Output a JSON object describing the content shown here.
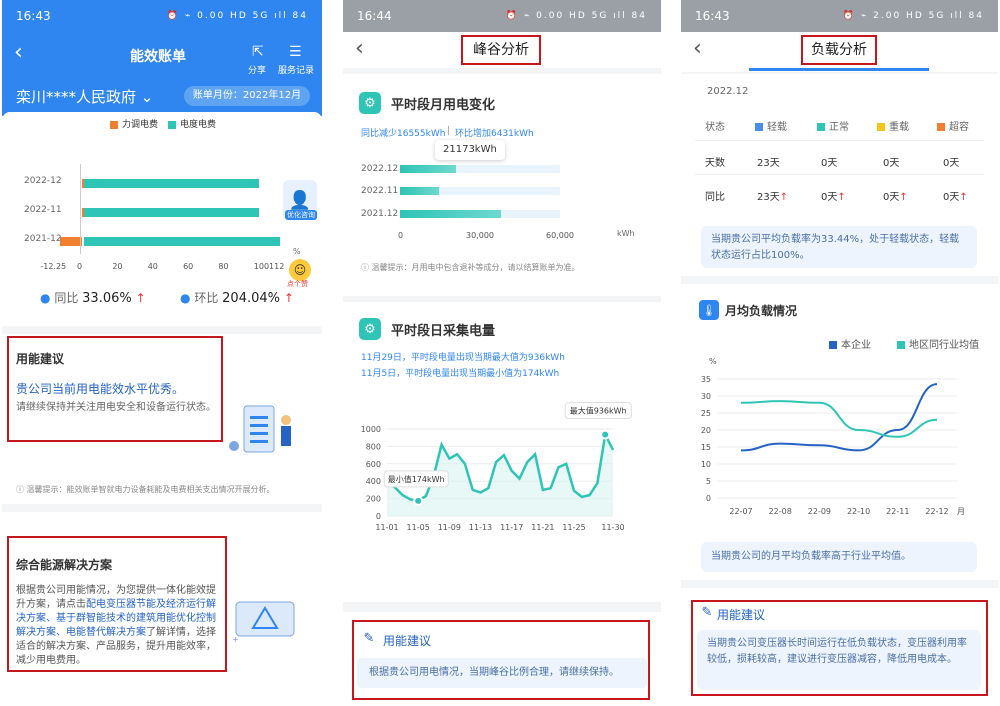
{
  "p1": {
    "status_time": "16:43",
    "status_icons": "⏰ ⌁ 0.00 HD 5G ıll 84",
    "title": "能效账单",
    "share": "分享",
    "records": "服务记录",
    "org": "栾川****人民政府",
    "bill_month_label": "账单月份：2022年12月",
    "legend": [
      "力调电费",
      "电度电费"
    ],
    "rows": [
      "2022-12",
      "2022-11",
      "2021-12"
    ],
    "xticks": [
      "-12.25",
      "0",
      "20",
      "40",
      "60",
      "80",
      "100112"
    ],
    "yoy_label": "同比",
    "yoy_value": "33.06%",
    "mom_label": "环比",
    "mom_value": "204.04%",
    "pct": "%",
    "optimize": "优化咨询",
    "click": "点个赞",
    "advice_title": "用能建议",
    "advice_head": "贵公司当前用电能效水平优秀。",
    "advice_body": "请继续保持并关注用电安全和设备运行状态。",
    "tip": "温馨提示：能效账单智就电力设备耗能及电费相关支出情况开展分析。",
    "solution_title": "综合能源解决方案",
    "solution_body": [
      "根据贵公司用能情况，为您提供一体化能效提升方案，请点击",
      "配电变压器节能及经济运行解决方案、基于群智能技术的建筑用能优化控制解决方案、电能替代解决方案",
      "了解详情，选择适合的解决方案、产品服务，提升用能效率，减少用电费用。"
    ]
  },
  "p2": {
    "status_time": "16:44",
    "status_icons": "⏰ ⌁ 0.00 HD 5G ıll 84",
    "title": "峰谷分析",
    "sec1_title": "平时段月用电变化",
    "sec1_yoy": "同比减少16555kWh",
    "sec1_mom": "环比增加6431kWh",
    "tooltip": "21173kWh",
    "rows": [
      "2022.12",
      "2022.11",
      "2021.12"
    ],
    "xticks": [
      "0",
      "30,000",
      "60,000"
    ],
    "xunit": "kWh",
    "tip": "温馨提示：月用电中包含退补等成分，请以结算账单为准。",
    "sec2_title": "平时段日采集电量",
    "line1": "11月29日，平时段电量出现当期最大值为936kWh",
    "line2": "11月5日，平时段电量出现当期最小值为174kWh",
    "max_label": "最大值936kWh",
    "min_label": "最小值174kWh",
    "yticks": [
      "1000",
      "800",
      "600",
      "400",
      "200",
      "0"
    ],
    "dates": [
      "11-01",
      "11-05",
      "11-09",
      "11-13",
      "11-17",
      "11-21",
      "11-25",
      "11-30"
    ],
    "advice_title": "用能建议",
    "advice_body": "根据贵公司用电情况，当期峰谷比例合理，请继续保持。"
  },
  "p3": {
    "status_time": "16:43",
    "status_icons": "⏰ ⌁ 2.00 HD 5G ıll 84",
    "title": "负载分析",
    "month": "2022.12",
    "table": {
      "head": [
        "状态",
        "轻载",
        "正常",
        "重载",
        "超容"
      ],
      "r1": [
        "天数",
        "23天",
        "0天",
        "0天",
        "0天"
      ],
      "r2": [
        "同比",
        "23天",
        "0天",
        "0天",
        "0天"
      ]
    },
    "note1": "当期贵公司平均负载率为33.44%，处于轻载状态，轻载状态运行占比100%。",
    "sec_title": "月均负载情况",
    "legend": [
      "本企业",
      "地区同行业均值"
    ],
    "yunit": "%",
    "yticks": [
      "35",
      "30",
      "25",
      "20",
      "15",
      "10",
      "5",
      "0"
    ],
    "xticks": [
      "22-07",
      "22-08",
      "22-09",
      "22-10",
      "22-11",
      "22-12",
      "月"
    ],
    "note2": "当期贵公司的月平均负载率高于行业平均值。",
    "advice_title": "用能建议",
    "advice_body": "当期贵公司变压器长时间运行在低负载状态，变压器利用率较低，损耗较高，建议进行变压器减容，降低用电成本。"
  },
  "colors": {
    "blue": "#2f86f0",
    "teal": "#2ec4b6",
    "orange": "#f07f30",
    "red": "#c8161d",
    "dark": "#2563c4",
    "yellow": "#f5c518"
  },
  "chart_data": [
    {
      "type": "bar",
      "title": "",
      "categories": [
        "2022-12",
        "2022-11",
        "2021-12"
      ],
      "series": [
        {
          "name": "力调电费",
          "values": [
            0,
            0,
            -12.25
          ]
        },
        {
          "name": "电度电费",
          "values": [
            100,
            100,
            112
          ]
        }
      ],
      "xlim": [
        -12.25,
        112
      ]
    },
    {
      "type": "bar",
      "title": "平时段月用电变化",
      "categories": [
        "2022.12",
        "2022.11",
        "2021.12"
      ],
      "values": [
        21173,
        14742,
        37728
      ],
      "xlim": [
        0,
        60000
      ],
      "xlabel": "kWh"
    },
    {
      "type": "line",
      "title": "平时段日采集电量",
      "x": [
        "11-01",
        "11-02",
        "11-03",
        "11-04",
        "11-05",
        "11-06",
        "11-07",
        "11-08",
        "11-09",
        "11-10",
        "11-11",
        "11-12",
        "11-13",
        "11-14",
        "11-15",
        "11-16",
        "11-17",
        "11-18",
        "11-19",
        "11-20",
        "11-21",
        "11-22",
        "11-23",
        "11-24",
        "11-25",
        "11-26",
        "11-27",
        "11-28",
        "11-29",
        "11-30"
      ],
      "values": [
        380,
        330,
        240,
        190,
        174,
        230,
        460,
        820,
        660,
        710,
        600,
        300,
        270,
        320,
        620,
        700,
        520,
        430,
        620,
        710,
        300,
        320,
        560,
        600,
        290,
        220,
        240,
        380,
        936,
        760
      ],
      "ylim": [
        0,
        1000
      ]
    },
    {
      "type": "line",
      "title": "月均负载情况",
      "x": [
        "22-07",
        "22-08",
        "22-09",
        "22-10",
        "22-11",
        "22-12"
      ],
      "series": [
        {
          "name": "本企业",
          "values": [
            14,
            16,
            15.5,
            14,
            20,
            33.5
          ]
        },
        {
          "name": "地区同行业均值",
          "values": [
            28,
            28.5,
            28,
            20,
            18,
            23
          ]
        }
      ],
      "ylim": [
        0,
        35
      ]
    }
  ]
}
